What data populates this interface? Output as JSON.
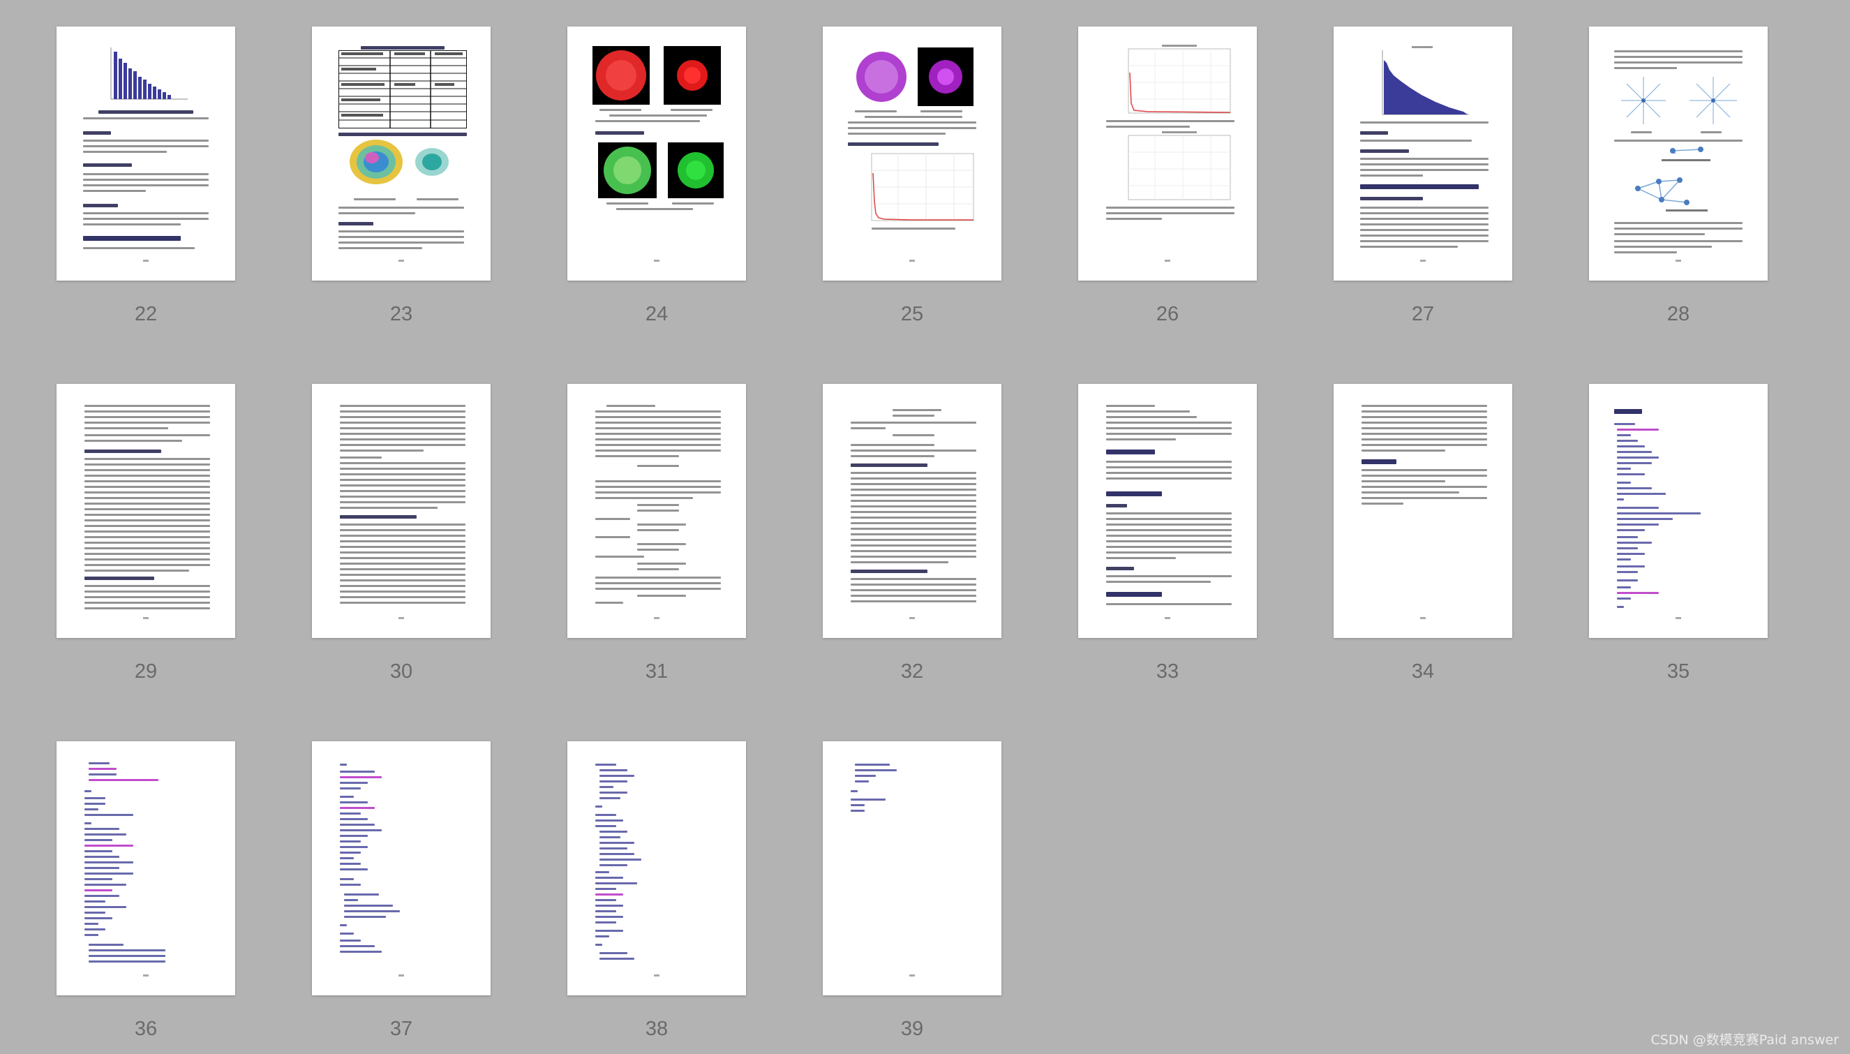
{
  "viewer": {
    "pages": [
      {
        "number": "22"
      },
      {
        "number": "23"
      },
      {
        "number": "24"
      },
      {
        "number": "25"
      },
      {
        "number": "26"
      },
      {
        "number": "27"
      },
      {
        "number": "28"
      },
      {
        "number": "29"
      },
      {
        "number": "30"
      },
      {
        "number": "31"
      },
      {
        "number": "32"
      },
      {
        "number": "33"
      },
      {
        "number": "34"
      },
      {
        "number": "35"
      },
      {
        "number": "36"
      },
      {
        "number": "37"
      },
      {
        "number": "38"
      },
      {
        "number": "39"
      }
    ]
  },
  "watermark": "CSDN @数模竞赛Paid answer",
  "colors": {
    "background": "#b3b3b3",
    "page": "#ffffff",
    "page_number": "#6a6a6a",
    "chart_bar": "#3b3b9a",
    "red_image": "#e02020",
    "green_image": "#30c040",
    "purple_image": "#b030d0"
  }
}
